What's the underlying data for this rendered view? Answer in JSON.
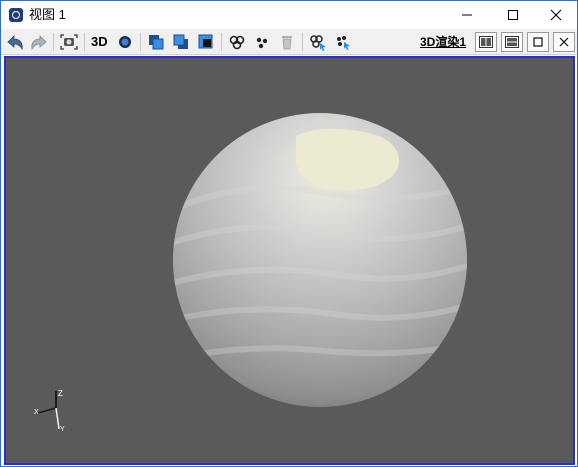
{
  "window": {
    "title": "视图 1",
    "icon": "app-logo-icon"
  },
  "controls": {
    "minimize": "minimize-icon",
    "maximize": "maximize-icon",
    "close": "close-icon"
  },
  "toolbar": {
    "view_3d_label": "3D",
    "render_label": "3D渲染1",
    "icons": [
      "undo-icon",
      "redo-icon",
      "camera-icon",
      "sphere-dot-icon",
      "bring-front-icon",
      "send-back-icon",
      "layer-icon",
      "group-icon",
      "points-icon",
      "trash-icon",
      "select-group-icon",
      "select-points-icon",
      "split-vertical-icon",
      "split-horizontal-icon",
      "restore-icon",
      "close-view-icon"
    ]
  },
  "axes": {
    "z": "Z",
    "x": "X",
    "y": "Y"
  },
  "colors": {
    "viewport_bg": "#5a5a5a",
    "viewport_border": "#2d2dcf",
    "highlight": "#ecebd2",
    "accent": "#2b6fd6"
  }
}
